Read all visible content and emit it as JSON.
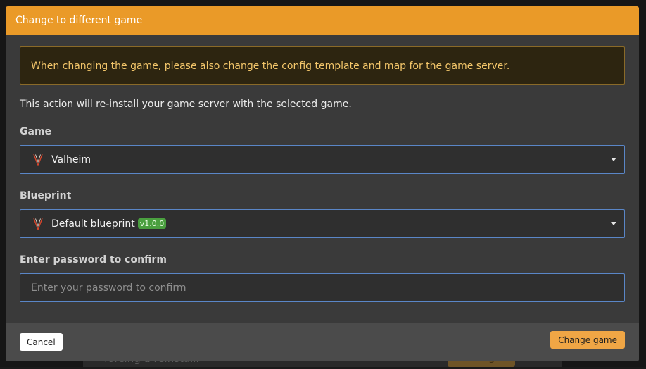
{
  "background": {
    "partial_text": "forcing a reinstall.",
    "partial_button": "Change"
  },
  "modal": {
    "title": "Change to different game",
    "warning": "When changing the game, please also change the config template and map for the game server.",
    "description": "This action will re-install your game server with the selected game.",
    "game": {
      "label": "Game",
      "selected": "Valheim",
      "icon": "valheim-logo-icon"
    },
    "blueprint": {
      "label": "Blueprint",
      "selected": "Default blueprint",
      "version": "v1.0.0",
      "icon": "valheim-logo-icon"
    },
    "password": {
      "label": "Enter password to confirm",
      "placeholder": "Enter your password to confirm",
      "value": ""
    },
    "buttons": {
      "cancel": "Cancel",
      "confirm": "Change game"
    }
  },
  "colors": {
    "header": "#ea9a28",
    "primary_button": "#f0a645",
    "input_border": "#5a86c7",
    "badge": "#4a9f3f",
    "warning_text": "#f3c66a"
  }
}
